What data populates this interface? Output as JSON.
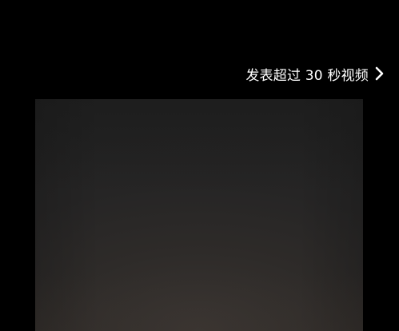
{
  "header": {
    "action_label": "发表超过 30 秒视频",
    "action_icon": "chevron-right-icon"
  },
  "colors": {
    "background": "#000000",
    "text": "#ffffff",
    "preview_base": "#2b2928"
  }
}
